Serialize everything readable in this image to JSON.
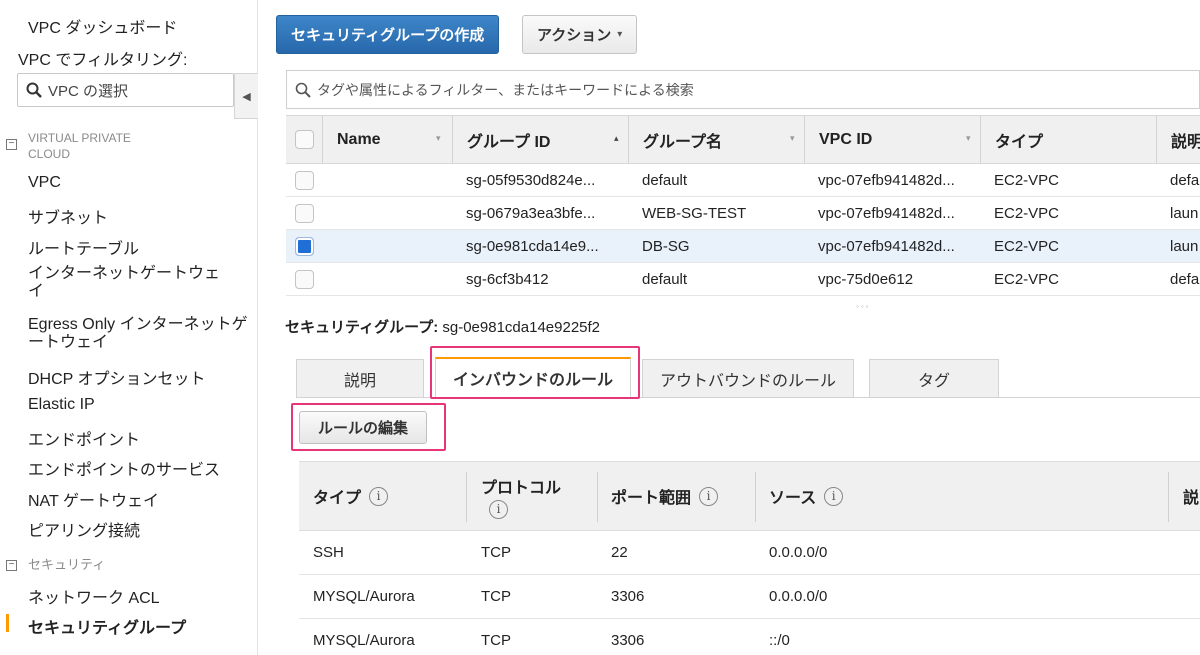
{
  "sidebar": {
    "dashboard": "VPC ダッシュボード",
    "filter_label": "VPC でフィルタリング:",
    "vpc_select_placeholder": "VPC の選択",
    "section_vpc": "VIRTUAL PRIVATE CLOUD",
    "items": [
      "VPC",
      "サブネット",
      "ルートテーブル",
      "インターネットゲートウェイ",
      "Egress Only インターネットゲートウェイ",
      "DHCP オプションセット",
      "Elastic IP",
      "エンドポイント",
      "エンドポイントのサービス",
      "NAT ゲートウェイ",
      "ピアリング接続"
    ],
    "section_security": "セキュリティ",
    "security_items": [
      "ネットワーク ACL",
      "セキュリティグループ"
    ]
  },
  "toolbar": {
    "create_label": "セキュリティグループの作成",
    "actions_label": "アクション"
  },
  "search": {
    "placeholder": "タグや属性によるフィルター、またはキーワードによる検索"
  },
  "grid": {
    "columns": [
      "Name",
      "グループ ID",
      "グループ名",
      "VPC ID",
      "タイプ",
      "説明"
    ],
    "rows": [
      {
        "name": "",
        "group_id": "sg-05f9530d824e...",
        "group_name": "default",
        "vpc_id": "vpc-07efb941482d...",
        "type": "EC2-VPC",
        "desc": "defa",
        "selected": false
      },
      {
        "name": "",
        "group_id": "sg-0679a3ea3bfe...",
        "group_name": "WEB-SG-TEST",
        "vpc_id": "vpc-07efb941482d...",
        "type": "EC2-VPC",
        "desc": "laun",
        "selected": false
      },
      {
        "name": "",
        "group_id": "sg-0e981cda14e9...",
        "group_name": "DB-SG",
        "vpc_id": "vpc-07efb941482d...",
        "type": "EC2-VPC",
        "desc": "laun",
        "selected": true
      },
      {
        "name": "",
        "group_id": "sg-6cf3b412",
        "group_name": "default",
        "vpc_id": "vpc-75d0e612",
        "type": "EC2-VPC",
        "desc": "defa",
        "selected": false
      }
    ]
  },
  "detail": {
    "title_label": "セキュリティグループ:",
    "title_value": "sg-0e981cda14e9225f2",
    "tabs": [
      "説明",
      "インバウンドのルール",
      "アウトバウンドのルール",
      "タグ"
    ],
    "active_tab": "インバウンドのルール",
    "edit_button": "ルールの編集"
  },
  "rules": {
    "columns": [
      "タイプ",
      "プロトコル",
      "ポート範囲",
      "ソース",
      "説"
    ],
    "rows": [
      {
        "type": "SSH",
        "protocol": "TCP",
        "port": "22",
        "source": "0.0.0.0/0"
      },
      {
        "type": "MYSQL/Aurora",
        "protocol": "TCP",
        "port": "3306",
        "source": "0.0.0.0/0"
      },
      {
        "type": "MYSQL/Aurora",
        "protocol": "TCP",
        "port": "3306",
        "source": "::/0"
      }
    ]
  },
  "colors": {
    "primary": "#2e73b8",
    "highlight": "#e8357a",
    "active_marker": "#ff9900",
    "selected_row": "#e9f1fb"
  }
}
